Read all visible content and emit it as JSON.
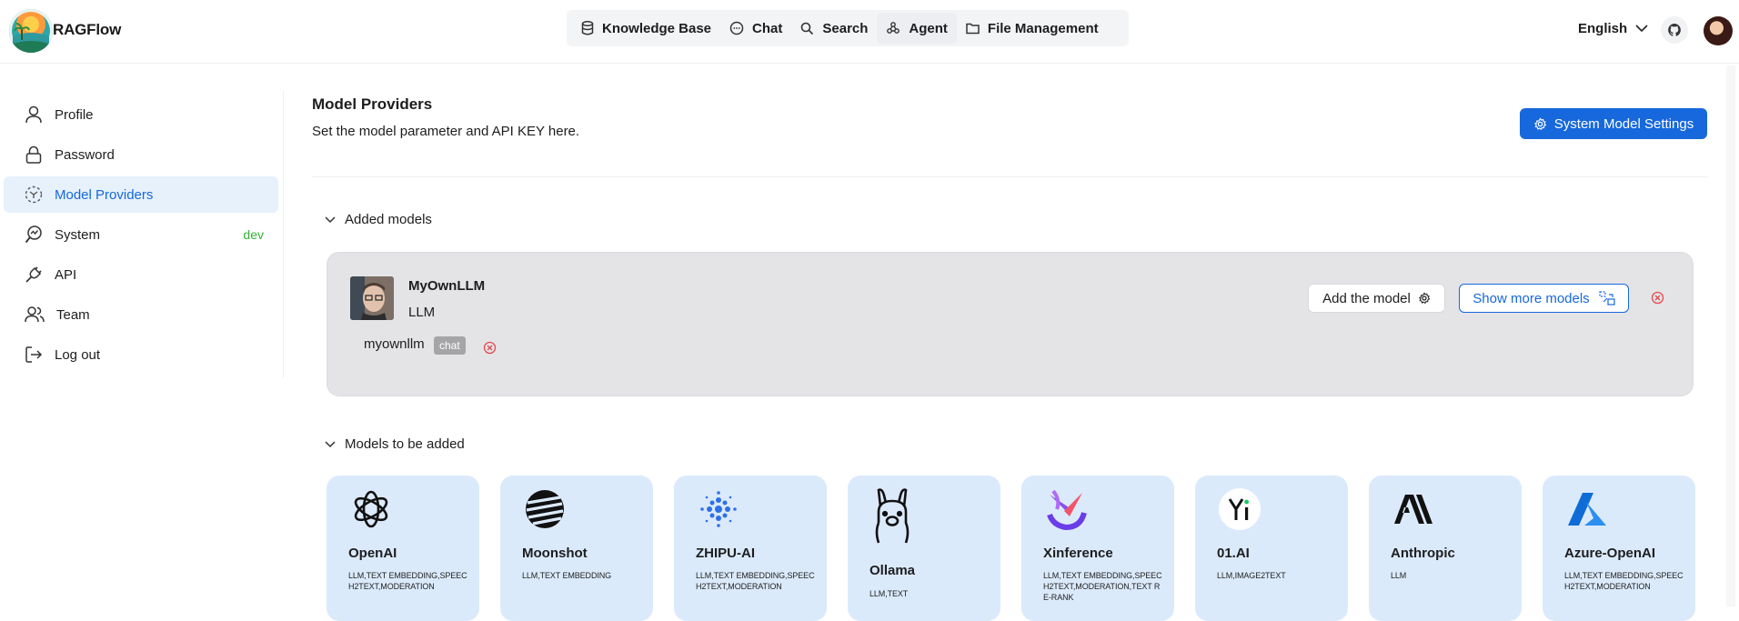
{
  "header": {
    "brand": "RAGFlow",
    "nav": [
      {
        "label": "Knowledge Base",
        "icon": "database-icon"
      },
      {
        "label": "Chat",
        "icon": "chat-bubble-icon"
      },
      {
        "label": "Search",
        "icon": "search-icon"
      },
      {
        "label": "Agent",
        "icon": "agent-graph-icon"
      },
      {
        "label": "File Management",
        "icon": "folder-icon"
      }
    ],
    "active_nav": "Agent",
    "language": "English"
  },
  "sidebar": {
    "items": [
      {
        "label": "Profile",
        "icon": "user-icon"
      },
      {
        "label": "Password",
        "icon": "lock-icon"
      },
      {
        "label": "Model Providers",
        "icon": "model-providers-icon"
      },
      {
        "label": "System",
        "icon": "system-monitor-icon",
        "badge": "dev"
      },
      {
        "label": "API",
        "icon": "plug-icon"
      },
      {
        "label": "Team",
        "icon": "team-icon"
      },
      {
        "label": "Log out",
        "icon": "logout-icon"
      }
    ],
    "active": "Model Providers"
  },
  "main": {
    "title": "Model Providers",
    "subtitle": "Set the model parameter and API KEY here.",
    "system_button": "System Model Settings",
    "added_section": "Added models",
    "to_add_section": "Models to be added",
    "added_models": [
      {
        "name": "MyOwnLLM",
        "tags": "LLM",
        "add_button": "Add the model",
        "more_button": "Show more models",
        "models": [
          {
            "name": "myownllm",
            "type": "chat"
          }
        ]
      }
    ],
    "providers": [
      {
        "name": "OpenAI",
        "tags": "LLM,TEXT EMBEDDING,SPEECH2TEXT,MODERATION",
        "logo": "openai-icon"
      },
      {
        "name": "Moonshot",
        "tags": "LLM,TEXT EMBEDDING",
        "logo": "moonshot-icon"
      },
      {
        "name": "ZHIPU-AI",
        "tags": "LLM,TEXT EMBEDDING,SPEECH2TEXT,MODERATION",
        "logo": "zhipu-icon"
      },
      {
        "name": "Ollama",
        "tags": "LLM,TEXT",
        "logo": "ollama-icon"
      },
      {
        "name": "Xinference",
        "tags": "LLM,TEXT EMBEDDING,SPEECH2TEXT,MODERATION,TEXT RE-RANK",
        "logo": "xinference-icon"
      },
      {
        "name": "01.AI",
        "tags": "LLM,IMAGE2TEXT",
        "logo": "01ai-icon"
      },
      {
        "name": "Anthropic",
        "tags": "LLM",
        "logo": "anthropic-icon"
      },
      {
        "name": "Azure-OpenAI",
        "tags": "LLM,TEXT EMBEDDING,SPEECH2TEXT,MODERATION",
        "logo": "azure-icon"
      }
    ]
  },
  "colors": {
    "accent": "#1668dc",
    "active_bg": "#e6f1fc",
    "card_bg": "#dbeafb",
    "added_card_bg": "#e4e4e7",
    "badge_green": "#34b233",
    "delete_red": "#e5484d"
  }
}
